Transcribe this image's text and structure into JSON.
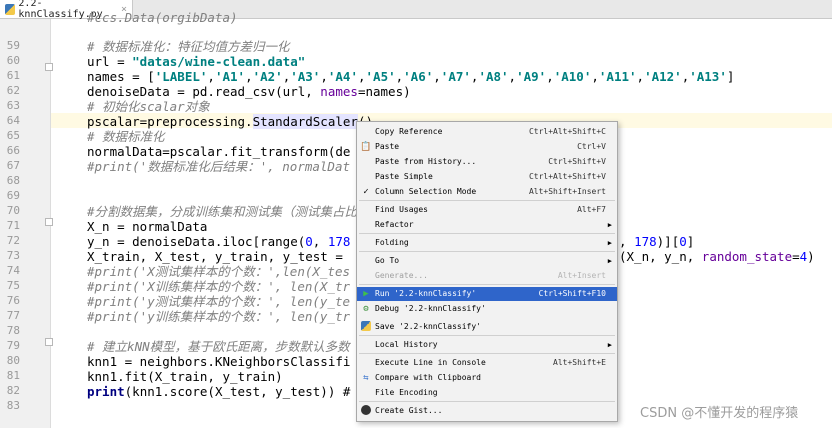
{
  "tab": {
    "filename": "2.2-knnClassify.py",
    "close": "×"
  },
  "gutter": {
    "line_numbers": [
      "59",
      "60",
      "61",
      "62",
      "63",
      "64",
      "65",
      "66",
      "67",
      "68",
      "69",
      "70",
      "71",
      "72",
      "73",
      "74",
      "75",
      "76",
      "77",
      "78",
      "79",
      "80",
      "81",
      "82",
      "83"
    ]
  },
  "code": {
    "l58": "#ccs.Data(orgibData)",
    "l60": "# 数据标准化：特征均值方差归一化",
    "l61a": "url = ",
    "l61b": "\"datas/wine-clean.data\"",
    "l62a": "names = [",
    "l62b": "'LABEL'",
    "l62c": ",",
    "l62d": "'A1'",
    "l62e": "'A2'",
    "l62f": "'A3'",
    "l62g": "'A4'",
    "l62h": "'A5'",
    "l62i": "'A6'",
    "l62j": "'A7'",
    "l62k": "'A8'",
    "l62l": "'A9'",
    "l62m": "'A10'",
    "l62n": "'A11'",
    "l62o": "'A12'",
    "l62p": "'A13'",
    "l62q": "]",
    "l63a": "denoiseData = pd.read_csv(url, ",
    "l63b": "names",
    "l63c": "=names)",
    "l64": "# 初始化scalar对象",
    "l65a": "pscalar=preprocessing.",
    "l65b": "StandardScaler",
    "l65c": "()",
    "l66": "# 数据标准化",
    "l67": "normalData=pscalar.fit_transform(de",
    "l68": "#print('数据标准化后结果：', normalDat",
    "l71": "#分割数据集，分成训练集和测试集（测试集占比",
    "l72": "X_n = normalData",
    "l73a": "y_n = denoiseData.iloc[range(",
    "l73b": "0",
    "l73c": ", ",
    "l73d": "178",
    "l73e": ", ",
    "l73f": "178",
    "l73g": ")][",
    "l73h": "0",
    "l73i": "]",
    "l74a": "X_train, X_test, y_train, y_test = ",
    "l74b": "(X_n, y_n, ",
    "l74c": "random_state",
    "l74d": "=",
    "l74e": "4",
    "l74f": ")",
    "l75": "#print('X测试集样本的个数：',len(X_tes",
    "l76": "#print('X训练集样本的个数：', len(X_tr",
    "l77": "#print('y测试集样本的个数：', len(y_te",
    "l78": "#print('y训练集样本的个数：', len(y_tr",
    "l80": "# 建立kNN模型，基于欧氏距离，步数默认多数",
    "l81": "knn1 = neighbors.KNeighborsClassifi",
    "l82": "knn1.fit(X_train, y_train)",
    "l83a": "print",
    "l83b": "(knn1.score(X_test, y_test)) #"
  },
  "menu": {
    "copy_reference": {
      "label": "Copy Reference",
      "shortcut": "Ctrl+Alt+Shift+C"
    },
    "paste": {
      "label": "Paste",
      "shortcut": "Ctrl+V"
    },
    "paste_history": {
      "label": "Paste from History...",
      "shortcut": "Ctrl+Shift+V"
    },
    "paste_simple": {
      "label": "Paste Simple",
      "shortcut": "Ctrl+Alt+Shift+V"
    },
    "column_selection": {
      "label": "Column Selection Mode",
      "shortcut": "Alt+Shift+Insert"
    },
    "find_usages": {
      "label": "Find Usages",
      "shortcut": "Alt+F7"
    },
    "refactor": {
      "label": "Refactor"
    },
    "folding": {
      "label": "Folding"
    },
    "goto": {
      "label": "Go To"
    },
    "generate": {
      "label": "Generate...",
      "shortcut": "Alt+Insert"
    },
    "run": {
      "label": "Run '2.2-knnClassify'",
      "shortcut": "Ctrl+Shift+F10"
    },
    "debug": {
      "label": "Debug '2.2-knnClassify'"
    },
    "save": {
      "label": "Save '2.2-knnClassify'"
    },
    "local_history": {
      "label": "Local History"
    },
    "execute_line": {
      "label": "Execute Line in Console",
      "shortcut": "Alt+Shift+E"
    },
    "compare_clipboard": {
      "label": "Compare with Clipboard"
    },
    "file_encoding": {
      "label": "File Encoding"
    },
    "create_gist": {
      "label": "Create Gist..."
    }
  },
  "watermark": "CSDN @不懂开发的程序猿",
  "colors": {
    "selection": "#2f65ca",
    "menu_bg": "#f2f2f2",
    "string": "#008080",
    "comment": "#808080",
    "current_line": "#fffae3"
  }
}
